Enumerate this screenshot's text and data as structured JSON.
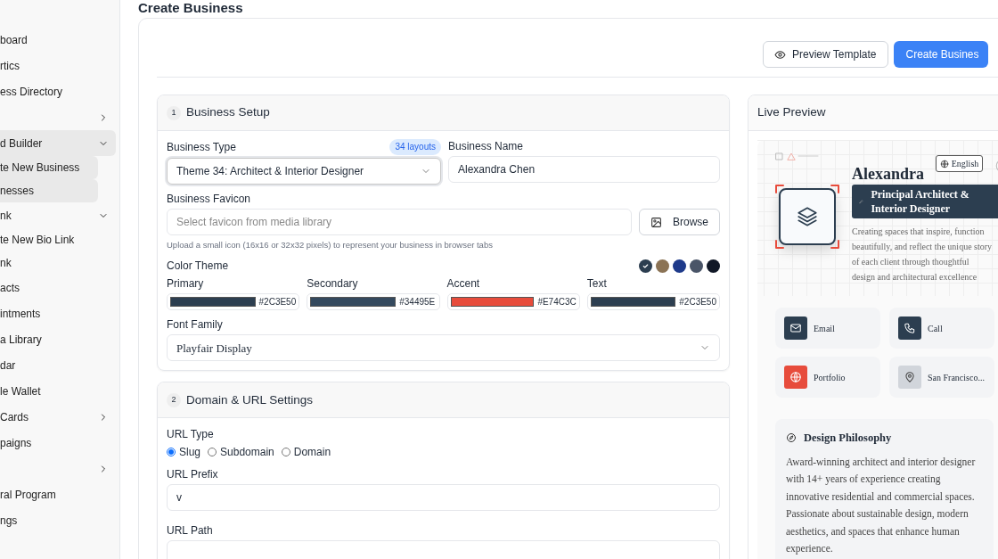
{
  "sidebar": {
    "items": [
      {
        "label": "board",
        "kind": "link",
        "selected": false
      },
      {
        "label": "rtics",
        "kind": "link",
        "selected": false
      },
      {
        "label": "ess Directory",
        "kind": "link",
        "selected": false
      },
      {
        "kind": "group",
        "expanded": false,
        "selected": false
      },
      {
        "label": "d Builder",
        "kind": "group",
        "expanded": true,
        "selected": true
      },
      {
        "label": "te New Business",
        "kind": "sub",
        "selected": true
      },
      {
        "label": "nesses",
        "kind": "sub",
        "selected": true
      },
      {
        "label": "nk",
        "kind": "group",
        "expanded": true,
        "selected": false
      },
      {
        "label": "te New Bio Link",
        "kind": "sub",
        "selected": false
      },
      {
        "label": "nk",
        "kind": "sub",
        "selected": false
      },
      {
        "label": "acts",
        "kind": "link",
        "selected": false
      },
      {
        "label": "intments",
        "kind": "link",
        "selected": false
      },
      {
        "label": "a Library",
        "kind": "link",
        "selected": false
      },
      {
        "label": "dar",
        "kind": "link",
        "selected": false
      },
      {
        "label": "le Wallet",
        "kind": "link",
        "selected": false
      },
      {
        "label": "Cards",
        "kind": "group",
        "expanded": false,
        "selected": false
      },
      {
        "label": "paigns",
        "kind": "link",
        "selected": false
      },
      {
        "kind": "group",
        "expanded": false,
        "selected": false
      },
      {
        "label": "ral Program",
        "kind": "link",
        "selected": false
      },
      {
        "label": "ngs",
        "kind": "link",
        "selected": false
      }
    ]
  },
  "page_title": "Create Business",
  "actions": [
    {
      "label": "Preview Template",
      "kind": "outline"
    },
    {
      "label": "Create Busines",
      "kind": "primary"
    }
  ],
  "setup": {
    "number": "1",
    "title": "Business Setup",
    "business_type": {
      "label": "Business Type",
      "badge": "34 layouts",
      "value": "Theme 34: Architect & Interior Designer"
    },
    "business_name": {
      "label": "Business Name",
      "value": "Alexandra Chen"
    },
    "favicon": {
      "label": "Business Favicon",
      "placeholder": "Select favicon from media library",
      "button": "Browse",
      "help": "Upload a small icon (16x16 or 32x32 pixels) to represent your business in browser tabs"
    },
    "color_theme": {
      "label": "Color Theme",
      "presets": [
        {
          "color": "#2c3e50",
          "selected": true
        },
        {
          "color": "#8b7355",
          "selected": false
        },
        {
          "color": "#1e3a8a",
          "selected": false
        },
        {
          "color": "#4a5568",
          "selected": false
        },
        {
          "color": "#111827",
          "selected": false
        }
      ],
      "colors": [
        {
          "label": "Primary",
          "color": "#2c3e50",
          "value": "#2C3E50"
        },
        {
          "label": "Secondary",
          "color": "#34495e",
          "value": "#34495E"
        },
        {
          "label": "Accent",
          "color": "#e74c3c",
          "value": "#E74C3C"
        },
        {
          "label": "Text",
          "color": "#2c3e50",
          "value": "#2C3E50"
        }
      ]
    },
    "font_family": {
      "label": "Font Family",
      "value": "Playfair Display"
    }
  },
  "domain": {
    "number": "2",
    "title": "Domain & URL Settings",
    "url_type": {
      "label": "URL Type",
      "options": [
        {
          "label": "Slug",
          "selected": true
        },
        {
          "label": "Subdomain",
          "selected": false
        },
        {
          "label": "Domain",
          "selected": false
        }
      ]
    },
    "url_prefix": {
      "label": "URL Prefix",
      "value": "v"
    },
    "url_path": {
      "label": "URL Path"
    }
  },
  "preview": {
    "title": "Live Preview",
    "name": "Alexandra",
    "language": "English",
    "role": "Principal Architect & Interior Designer",
    "tagline": "Creating spaces that inspire, function beautifully, and reflect the unique story of each client through thoughtful design and architectural excellence",
    "contacts": [
      {
        "kind": "email",
        "label": "Email",
        "color": "#2c3e50"
      },
      {
        "kind": "phone",
        "label": "Call",
        "color": "#2c3e50"
      },
      {
        "kind": "globe",
        "label": "Portfolio",
        "color": "#e74c3c"
      },
      {
        "kind": "location",
        "label": "San Francisco...",
        "color": "#d1d5db"
      }
    ],
    "philosophy": {
      "title": "Design Philosophy",
      "text": "Award-winning architect and interior designer with 14+ years of experience creating innovative residential and commercial spaces. Passionate about sustainable design, modern aesthetics, and spaces that enhance human experience."
    }
  }
}
